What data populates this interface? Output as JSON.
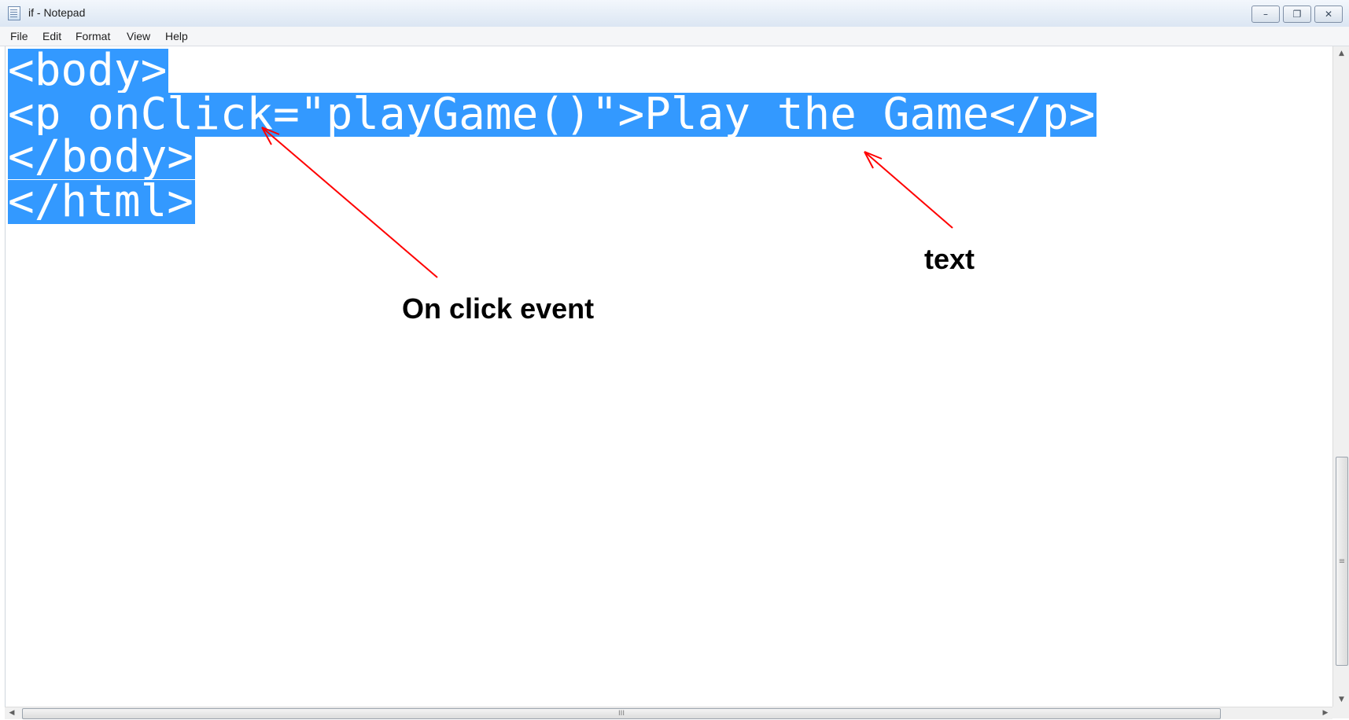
{
  "window": {
    "title": "if - Notepad",
    "caption_buttons": [
      {
        "name": "minimize-button",
        "glyph": "–"
      },
      {
        "name": "restore-button",
        "glyph": "❐"
      },
      {
        "name": "close-button",
        "glyph": "✕"
      }
    ]
  },
  "menu": {
    "items": [
      "File",
      "Edit",
      "Format",
      "View",
      "Help"
    ]
  },
  "editor": {
    "lines": [
      "<body>",
      "<p onClick=\"playGame()\">Play the Game</p>",
      "</body>",
      "</html>"
    ],
    "selection_color": "#3399ff",
    "text_color": "#ffffff"
  },
  "annotations": {
    "onclick_label": "On click event",
    "text_label": "text",
    "arrow_color": "#ff0000"
  },
  "scrollbars": {
    "h_thumb_grip": "III",
    "v_thumb_grip": "≡"
  }
}
